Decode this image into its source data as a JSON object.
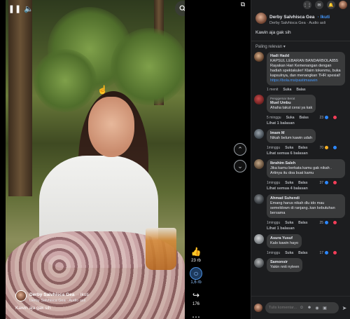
{
  "video": {
    "author": "Derby Salvhisca Gea",
    "follow_label": "· Ikuti",
    "audio": "Derby Salvhisca Gea · Audio asli",
    "caption": "Kawin aja gak sih",
    "actions": [
      {
        "icon": "like-icon",
        "count": "23 rb"
      },
      {
        "icon": "comment-icon",
        "count": "1,6 rb"
      },
      {
        "icon": "share-icon",
        "count": "176"
      },
      {
        "icon": "more-icon",
        "count": ""
      }
    ]
  },
  "panel": {
    "author": "Derby Salvhisca Gea",
    "follow_label": "· Ikuti",
    "audio": "Derby Salvhisca Gea · Audio asli",
    "caption": "Kawin aja gak sih",
    "sort_label": "Paling relevan",
    "composer_placeholder": "Tulis komentar..."
  },
  "comments": [
    {
      "name": "Hadi Hadd",
      "badge": "",
      "text": "KAPSUL LEBARAN BANDARBOLA855 Rayakan Hari Kemenangan dengan hadiah spektakuler! Klaim tokenmu, buka kapsulnya, dan menangkan THR spesial!",
      "link": "https://bola.ms/pastimaswin",
      "time": "1 menit",
      "like": "Suka",
      "reply": "Balas",
      "reactions": "",
      "replies": ""
    },
    {
      "name": "Muel Umbu",
      "badge": "Penggemar Berat",
      "text": "Ahaha takut cerai ya kak",
      "link": "",
      "time": "5 minggu",
      "like": "Suka",
      "reply": "Balas",
      "reactions": "23",
      "replies": "Lihat 1 balasan"
    },
    {
      "name": "Imam M",
      "badge": "",
      "text": "Nikah belum kawin udah",
      "link": "",
      "time": "1minggu",
      "like": "Suka",
      "reply": "Balas",
      "reactions": "70",
      "replies": "Lihat semua 6 balasan"
    },
    {
      "name": "Ibrahim Saleh",
      "badge": "",
      "text": "Jika kamu berkata kamu gak nikah . Artinya itu doa buat kamu",
      "link": "",
      "time": "1minggu",
      "like": "Suka",
      "reply": "Balas",
      "reactions": "37",
      "replies": "Lihat semua 4 balasan"
    },
    {
      "name": "Ahmad Suhendi",
      "badge": "",
      "text": "Emang harus nikah dlu ido mau semeldown di ranjang..kan kebutuhan bersama",
      "link": "",
      "time": "1minggu",
      "like": "Suka",
      "reply": "Balas",
      "reactions": "25",
      "replies": "Lihat 1 balasan"
    },
    {
      "name": "Asura Yusuf",
      "badge": "",
      "text": "Kalo kawin hayo",
      "link": "",
      "time": "1minggu",
      "like": "Suka",
      "reply": "Balas",
      "reactions": "17",
      "replies": ""
    },
    {
      "name": "Samonsir",
      "badge": "",
      "text": "Yakin nnti nyleen",
      "link": "",
      "time": "",
      "like": "",
      "reply": "",
      "reactions": "",
      "replies": ""
    }
  ],
  "colors": {
    "link": "#4599ff",
    "panel_bg": "#1c1d1f",
    "bubble_bg": "#3a3b3c",
    "like_reaction": "#2d88ff",
    "love_reaction": "#f33e58",
    "haha_reaction": "#f7b125"
  }
}
